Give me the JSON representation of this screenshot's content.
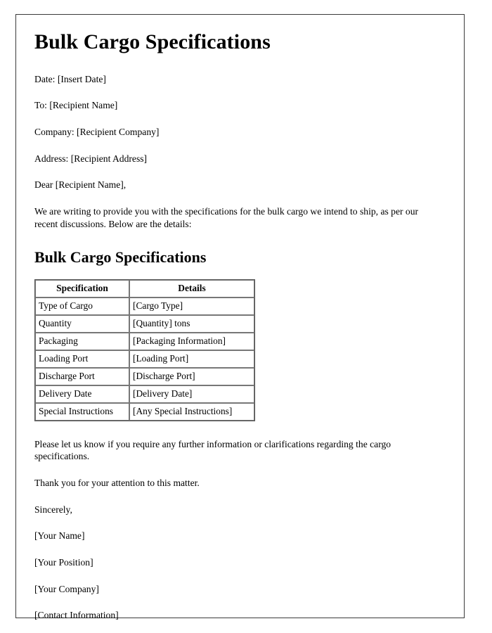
{
  "document": {
    "title": "Bulk Cargo Specifications",
    "header_fields": [
      {
        "label": "Date:",
        "value": "[Insert Date]",
        "text": "Date: [Insert Date]"
      },
      {
        "label": "To:",
        "value": "[Recipient Name]",
        "text": "To: [Recipient Name]"
      },
      {
        "label": "Company:",
        "value": "[Recipient Company]",
        "text": "Company: [Recipient Company]"
      },
      {
        "label": "Address:",
        "value": "[Recipient Address]",
        "text": "Address: [Recipient Address]"
      }
    ],
    "salutation": "Dear [Recipient Name],",
    "intro_paragraph": "We are writing to provide you with the specifications for the bulk cargo we intend to ship, as per our recent discussions. Below are the details:",
    "section_heading": "Bulk Cargo Specifications",
    "table": {
      "columns": [
        "Specification",
        "Details"
      ],
      "rows": [
        [
          "Type of Cargo",
          "[Cargo Type]"
        ],
        [
          "Quantity",
          "[Quantity] tons"
        ],
        [
          "Packaging",
          "[Packaging Information]"
        ],
        [
          "Loading Port",
          "[Loading Port]"
        ],
        [
          "Discharge Port",
          "[Discharge Port]"
        ],
        [
          "Delivery Date",
          "[Delivery Date]"
        ],
        [
          "Special Instructions",
          "[Any Special Instructions]"
        ]
      ]
    },
    "closing_paragraph": "Please let us know if you require any further information or clarifications regarding the cargo specifications.",
    "thanks_paragraph": "Thank you for your attention to this matter.",
    "signoff": "Sincerely,",
    "signature_block": [
      "[Your Name]",
      "[Your Position]",
      "[Your Company]",
      "[Contact Information]"
    ]
  },
  "colors": {
    "page_border": "#3a3a3a",
    "text": "#000000",
    "table_border": "#777777",
    "table_outer_border": "#555555",
    "background": "#ffffff"
  }
}
